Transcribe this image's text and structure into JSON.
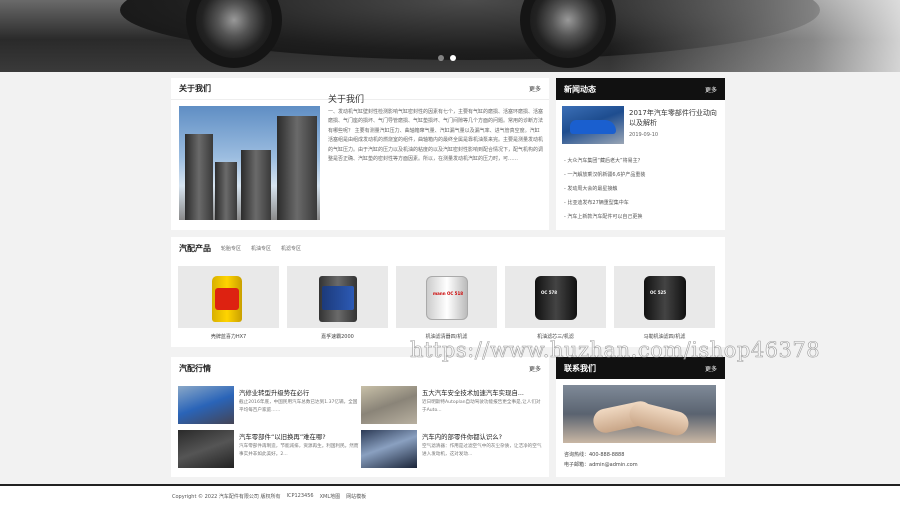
{
  "about": {
    "heading": "关于我们",
    "more": "更多",
    "title": "关于我们",
    "text": "一、发动机气缸壁封性检测影响气缸密封性的因素有七个，主要有气缸的磨损、活塞环磨损、活塞磨损、气门座的损坏、气门导管磨损、气缸垫损坏、气门间隙等几个方面的问题。常用的诊断方法有哪些呢？ 主要有测量汽缸压力、曲轴箱窜气量、汽缸漏气量以及漏气率、进气管真空度。汽缸活塞组是由组成发动机的燃烧室的组件，曲轴箱内的最终全属是靠机油泵来完。主要是测量发动机的气缸压力。由于汽缸的压力以及机油的粘度的以及汽缸密封性影响到配合情况下，配气机构的调整是否正确、汽缸垫的密封性等方面因素。所以，在测量发动机汽缸的压力时，可……"
  },
  "news": {
    "heading": "新闻动态",
    "more": "更多",
    "featured": {
      "title": "2017年汽车零部件行业动向以及解析",
      "date": "2019-09-10"
    },
    "items": [
      "大众汽车集团“藏后老大”将易主？",
      "一汽解放乘汉帆新疆6,6护产品重装",
      "发动周大会的最星接触",
      "比亚迪发布27辆重型集中车",
      "汽车上新款汽车配件可以自己更换"
    ]
  },
  "products": {
    "heading": "汽配产品",
    "tabs": [
      "轮胎专区",
      "机油专区",
      "机滤专区"
    ],
    "items": [
      {
        "name": "壳牌蓝喜力HX7",
        "kind": "bottle",
        "label": ""
      },
      {
        "name": "嘉孚速霸2000",
        "kind": "can",
        "label": ""
      },
      {
        "name": "机油滤清器四/机滤",
        "kind": "filter-white",
        "label": "mann OC 518"
      },
      {
        "name": "机油滤芯三/机滤",
        "kind": "filter-black",
        "label": "OC 578"
      },
      {
        "name": "马勒机油滤四/机滤",
        "kind": "filter-black",
        "label": "OC 525"
      }
    ]
  },
  "market": {
    "heading": "汽配行情",
    "more": "更多",
    "items": [
      {
        "title": "汽修业转型升级势在必行",
        "desc": "截止2016年底，中国民用汽车总数已达到1.37亿辆，全国平均每百户家庭……"
      },
      {
        "title": "五大汽车安全技术加速汽车实现自...",
        "desc": "近日明斯特Autoplan自动驾驶功能报告更全事是,让人们对于Auto..."
      },
      {
        "title": "汽车零部件“以旧换再”难在哪?",
        "desc": "汽车零部件再制造，节能减排，资源再生。利国利民。然而事实并非如此美好。2..."
      },
      {
        "title": "汽车内的部零件你都认识么?",
        "desc": "空气滤清器：作用是过滤空气中的灰尘杂质，让洁净的空气进入发动机，这对发动..."
      }
    ]
  },
  "contact": {
    "heading": "联系我们",
    "more": "更多",
    "phone": "咨询热线：400-888-8888",
    "email": "电子邮箱：admin@admin.com"
  },
  "watermark": "https://www.huzhan.com/ishop46378",
  "footer": {
    "copyright": "Copyright © 2022 汽车配件有限公司 版权所有",
    "icp": "ICP123456",
    "links": [
      "XML地图",
      "网站模板"
    ]
  }
}
